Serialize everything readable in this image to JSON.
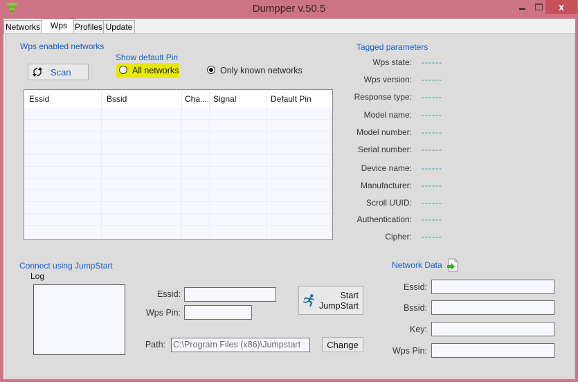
{
  "window": {
    "title": "Dumpper v.50.5",
    "icon": "wifi-signal-icon",
    "controls": {
      "minimize": "minimize-icon",
      "maximize": "maximize-icon",
      "close": "close-icon",
      "close_glyph": "x"
    }
  },
  "tabs": [
    {
      "label": "Networks",
      "active": false
    },
    {
      "label": "Wps",
      "active": true
    },
    {
      "label": "Profiles",
      "active": false
    },
    {
      "label": "Update",
      "active": false
    }
  ],
  "wps": {
    "group_title": "Wps enabled networks",
    "scan_button": {
      "label": "Scan",
      "icon": "refresh-icon"
    },
    "show_default_pin": {
      "label": "Show default Pin",
      "options": [
        {
          "label": "All networks",
          "checked": false,
          "highlighted": true
        },
        {
          "label": "Only known networks",
          "checked": true
        }
      ]
    },
    "table": {
      "columns": [
        "Essid",
        "Bssid",
        "Cha...",
        "Signal",
        "Default Pin"
      ],
      "rows": []
    }
  },
  "tagged": {
    "title": "Tagged parameters",
    "items": [
      {
        "label": "Wps state:",
        "value": "------"
      },
      {
        "label": "Wps version:",
        "value": "------"
      },
      {
        "label": "Response type:",
        "value": "------"
      },
      {
        "label": "Model name:",
        "value": "------"
      },
      {
        "label": "Model number:",
        "value": "------"
      },
      {
        "label": "Serial number:",
        "value": "------"
      },
      {
        "label": "Device name:",
        "value": "------"
      },
      {
        "label": "Manufacturer:",
        "value": "------"
      },
      {
        "label": "Scroll UUID:",
        "value": "------"
      },
      {
        "label": "Authentication:",
        "value": "------"
      },
      {
        "label": "Cipher:",
        "value": "------"
      }
    ]
  },
  "jumpstart": {
    "title": "Connect using JumpStart",
    "log_label": "Log",
    "log_value": "",
    "essid_label": "Essid:",
    "essid_value": "",
    "pin_label": "Wps Pin:",
    "pin_value": "",
    "start_button": {
      "line1": "Start",
      "line2": "JumpStart",
      "icon": "running-man-icon"
    },
    "path_label": "Path:",
    "path_value": "C:\\Program Files (x86)\\Jumpstart",
    "change_button": "Change"
  },
  "network_data": {
    "title": "Network Data",
    "export_icon": "export-file-icon",
    "fields": [
      {
        "label": "Essid:",
        "value": ""
      },
      {
        "label": "Bssid:",
        "value": ""
      },
      {
        "label": "Key:",
        "value": ""
      },
      {
        "label": "Wps Pin:",
        "value": ""
      }
    ]
  },
  "colors": {
    "titlebar": "#cc7485",
    "close": "#c7505a",
    "group_title": "#1a5fbf",
    "tag_value": "#1aa0a0",
    "highlight": "#e6ea00"
  }
}
